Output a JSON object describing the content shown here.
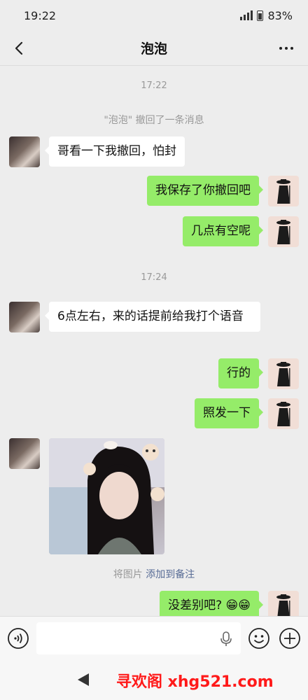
{
  "status_bar": {
    "time": "19:22",
    "battery_text": "83%"
  },
  "header": {
    "title": "泡泡",
    "back_icon": "chevron-left-icon",
    "more_icon": "more-dots-icon"
  },
  "messages": {
    "timestamp_1": "17:22",
    "recall_name": "\"泡泡\"",
    "recall_text": " 撤回了一条消息",
    "msg_1": "哥看一下我撤回，怕封",
    "msg_2": "我保存了你撤回吧",
    "msg_3": "几点有空呢",
    "timestamp_2": "17:24",
    "msg_4": "6点左右，来的话提前给我打个语音",
    "msg_5": "行的",
    "msg_6": "照发一下",
    "photo_note_prefix": "将图片 ",
    "photo_note_link": "添加到备注",
    "msg_7": "没差别吧? 😁😁"
  },
  "input_bar": {
    "placeholder": "",
    "voice_icon": "voice-icon",
    "mic_icon": "microphone-icon",
    "emoji_icon": "emoji-icon",
    "plus_icon": "plus-circle-icon"
  },
  "footer": {
    "watermark": "寻欢阁 xhg521.com"
  },
  "colors": {
    "outgoing_bubble": "#95ec69",
    "incoming_bubble": "#ffffff",
    "background": "#ededed",
    "link": "#576b95",
    "watermark": "#ff1a1a"
  }
}
